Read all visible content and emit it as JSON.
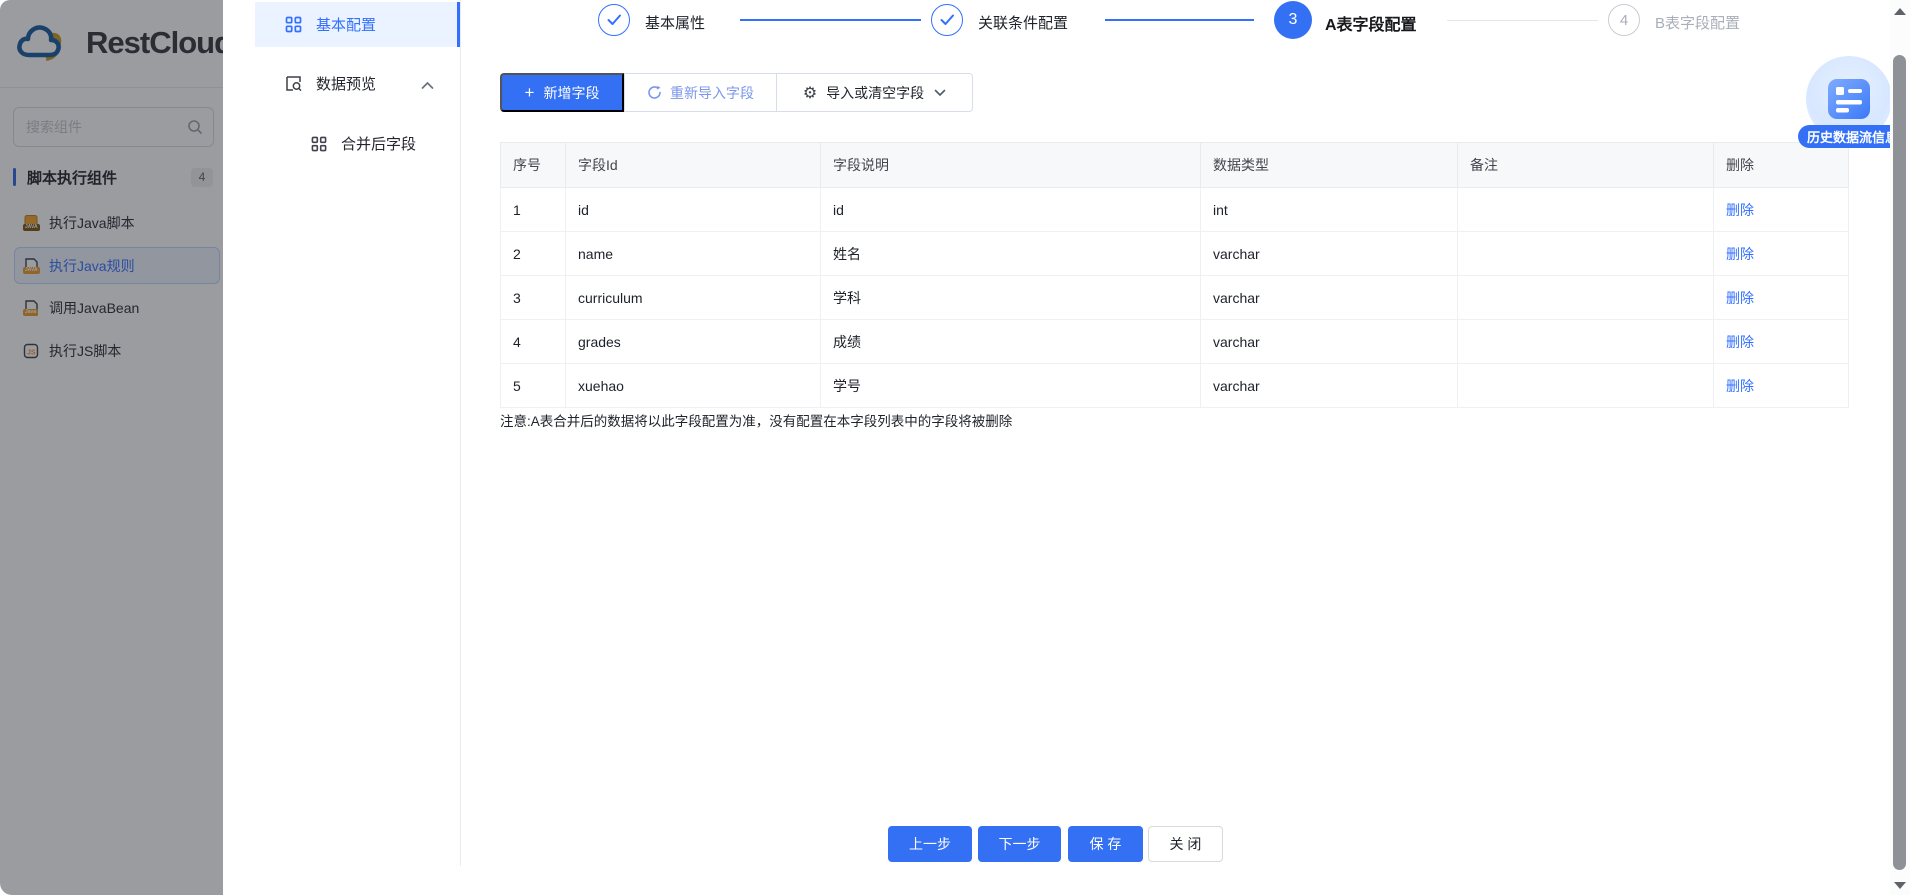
{
  "app": {
    "name": "RestCloud"
  },
  "sidebar": {
    "search_placeholder": "搜索组件",
    "section": {
      "title": "脚本执行组件",
      "count": "4"
    },
    "items": [
      {
        "label": "执行Java脚本",
        "badge": "JAVA"
      },
      {
        "label": "执行Java规则",
        "badge": "JAVA"
      },
      {
        "label": "调用JavaBean",
        "badge": "Java"
      },
      {
        "label": "执行JS脚本",
        "badge": "JS"
      }
    ]
  },
  "drawer": {
    "nav": [
      {
        "label": "基本配置"
      },
      {
        "label": "数据预览"
      },
      {
        "label": "合并后字段"
      }
    ],
    "steps": [
      {
        "label": "基本属性",
        "state": "done"
      },
      {
        "label": "关联条件配置",
        "state": "done"
      },
      {
        "label": "A表字段配置",
        "number": "3",
        "state": "active"
      },
      {
        "label": "B表字段配置",
        "number": "4",
        "state": "pending"
      }
    ],
    "toolbar": {
      "add_button": "新增字段",
      "reimport_button": "重新导入字段",
      "import_clear_button": "导入或清空字段"
    },
    "table": {
      "columns": [
        "序号",
        "字段Id",
        "字段说明",
        "数据类型",
        "备注",
        "删除"
      ],
      "rows": [
        {
          "seq": "1",
          "field_id": "id",
          "field_desc": "id",
          "data_type": "int",
          "remark": "",
          "action": "删除"
        },
        {
          "seq": "2",
          "field_id": "name",
          "field_desc": "姓名",
          "data_type": "varchar",
          "remark": "",
          "action": "删除"
        },
        {
          "seq": "3",
          "field_id": "curriculum",
          "field_desc": "学科",
          "data_type": "varchar",
          "remark": "",
          "action": "删除"
        },
        {
          "seq": "4",
          "field_id": "grades",
          "field_desc": "成绩",
          "data_type": "varchar",
          "remark": "",
          "action": "删除"
        },
        {
          "seq": "5",
          "field_id": "xuehao",
          "field_desc": "学号",
          "data_type": "varchar",
          "remark": "",
          "action": "删除"
        }
      ]
    },
    "note": "注意:A表合并后的数据将以此字段配置为准，没有配置在本字段列表中的字段将被删除",
    "footer_buttons": {
      "prev": "上一步",
      "next": "下一步",
      "save": "保 存",
      "close": "关 闭"
    }
  },
  "floating": {
    "badge": "历史数据流信息"
  },
  "colors": {
    "primary": "#3370ff",
    "button_blue": "#3370f4",
    "nav_selected_bg": "#eaf3ff",
    "badge_bg": "#3370f6",
    "dim_overlay": "rgba(33,36,43,0.45)"
  }
}
